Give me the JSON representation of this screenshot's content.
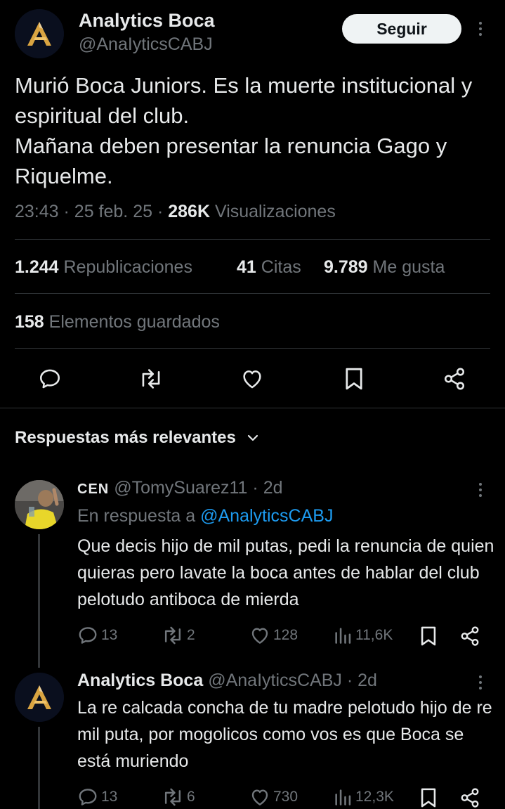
{
  "tweet": {
    "author_name": "Analytics Boca",
    "author_handle": "@AnaIyticsCABJ",
    "follow_label": "Seguir",
    "text": "Murió Boca Juniors. Es la muerte institucional y espiritual del club.\nMañana deben presentar la renuncia Gago y Riquelme.",
    "time": "23:43",
    "date": "25 feb. 25",
    "views_count": "286K",
    "views_label": "Visualizaciones",
    "reposts_count": "1.244",
    "reposts_label": "Republicaciones",
    "quotes_count": "41",
    "quotes_label": "Citas",
    "likes_count": "9.789",
    "likes_label": "Me gusta",
    "bookmarks_count": "158",
    "bookmarks_label": "Elementos guardados"
  },
  "replies_header": "Respuestas más relevantes",
  "replies": [
    {
      "name": "CEN",
      "handle": "@TomySuarez11",
      "time": "2d",
      "in_reply_prefix": "En respuesta a",
      "in_reply_handle": "@AnalyticsCABJ",
      "text": "Que decis hijo de mil putas, pedi la renuncia de quien quieras pero lavate la boca antes de hablar del club pelotudo antiboca de mierda",
      "replies": "13",
      "reposts": "2",
      "likes": "128",
      "views": "11,6K"
    },
    {
      "name": "Analytics Boca",
      "handle": "@AnaIyticsCABJ",
      "time": "2d",
      "text": "La re calcada concha de tu madre pelotudo hijo de re mil puta, por mogolicos como vos es que Boca se está muriendo",
      "replies": "13",
      "reposts": "6",
      "likes": "730",
      "views": "12,3K"
    }
  ],
  "colors": {
    "background": "#000000",
    "text": "#e7e9ea",
    "secondary": "#71767b",
    "link": "#1d9bf0",
    "divider": "#2f3336",
    "logo_gold": "#d9a441"
  }
}
